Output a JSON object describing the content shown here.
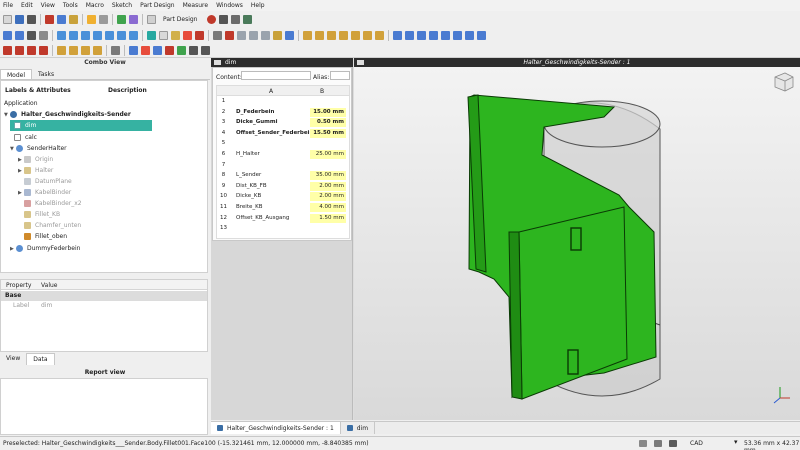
{
  "menu": [
    "File",
    "Edit",
    "View",
    "Tools",
    "Macro",
    "Sketch",
    "Part Design",
    "Measure",
    "Windows",
    "Help"
  ],
  "workbench": {
    "label": "Part Design"
  },
  "combo_view": {
    "title": "Combo View",
    "tabs": [
      "Model",
      "Tasks"
    ]
  },
  "tree": {
    "col_labels": "Labels & Attributes",
    "col_description": "Description",
    "root": "Application",
    "document": "Halter_Geschwindigkeits-Sender",
    "items": [
      {
        "label": "dim",
        "selected": true
      },
      {
        "label": "calc"
      },
      {
        "label": "SenderHalter"
      },
      {
        "label": "Origin",
        "hidden": true
      },
      {
        "label": "Halter",
        "hidden": true
      },
      {
        "label": "DatumPlane",
        "hidden": true
      },
      {
        "label": "KabelBinder",
        "hidden": true
      },
      {
        "label": "KabelBinder_x2",
        "hidden": true
      },
      {
        "label": "Fillet_KB",
        "hidden": true
      },
      {
        "label": "Chamfer_unten",
        "hidden": true
      },
      {
        "label": "Fillet_oben"
      },
      {
        "label": "DummyFederbein"
      }
    ]
  },
  "properties": {
    "col_property": "Property",
    "col_value": "Value",
    "group": "Base",
    "rows": [
      {
        "name": "Label",
        "value": "dim"
      }
    ],
    "tabs": [
      "View",
      "Data"
    ]
  },
  "report_view": {
    "title": "Report view"
  },
  "spreadsheet": {
    "title": "dim",
    "content_label": "Content:",
    "alias_label": "Alias:",
    "col_a": "A",
    "col_b": "B",
    "rows": [
      {
        "n": "1",
        "a": "",
        "b": ""
      },
      {
        "n": "2",
        "a": "D_Federbein",
        "b": "15.00 mm",
        "bold": true
      },
      {
        "n": "3",
        "a": "Dicke_Gummi",
        "b": "0.50 mm",
        "bold": true
      },
      {
        "n": "4",
        "a": "Offset_Sender_Federbein",
        "b": "15.50 mm",
        "bold": true
      },
      {
        "n": "5",
        "a": "",
        "b": ""
      },
      {
        "n": "6",
        "a": "H_Halter",
        "b": "25.00 mm"
      },
      {
        "n": "7",
        "a": "",
        "b": ""
      },
      {
        "n": "8",
        "a": "L_Sender",
        "b": "35.00 mm"
      },
      {
        "n": "9",
        "a": "Dist_KB_FB",
        "b": "2.00 mm"
      },
      {
        "n": "10",
        "a": "Dicke_KB",
        "b": "2.00 mm"
      },
      {
        "n": "11",
        "a": "Breite_KB",
        "b": "4.00 mm"
      },
      {
        "n": "12",
        "a": "Offset_KB_Ausgang",
        "b": "1.50 mm"
      },
      {
        "n": "13",
        "a": "",
        "b": ""
      }
    ]
  },
  "view3d": {
    "title": "Halter_Geschwindigkeits-Sender : 1",
    "model_color": "#2db51f"
  },
  "doc_tabs": [
    "Halter_Geschwindigkeits-Sender : 1",
    "dim"
  ],
  "status": {
    "preselected": "Preselected: Halter_Geschwindigkeits___Sender.Body.Fillet001.Face100 (-15.321461 mm, 12.000000 mm, -8.840385 mm)",
    "nav_style": "CAD",
    "dimensions": "53.36 mm x 42.37 mm"
  }
}
